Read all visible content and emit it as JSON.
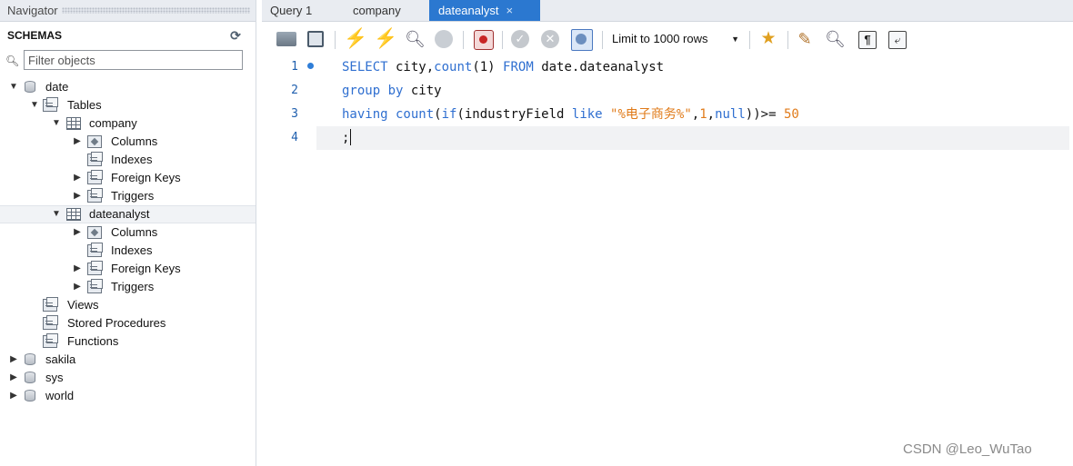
{
  "navigator": {
    "header": "Navigator",
    "section": "SCHEMAS",
    "filter_placeholder": "Filter objects",
    "tree": {
      "db_date": "date",
      "tables": "Tables",
      "company": "company",
      "company_columns": "Columns",
      "company_indexes": "Indexes",
      "company_fkeys": "Foreign Keys",
      "company_triggers": "Triggers",
      "dateanalyst": "dateanalyst",
      "da_columns": "Columns",
      "da_indexes": "Indexes",
      "da_fkeys": "Foreign Keys",
      "da_triggers": "Triggers",
      "views": "Views",
      "procs": "Stored Procedures",
      "functions": "Functions",
      "db_sakila": "sakila",
      "db_sys": "sys",
      "db_world": "world"
    }
  },
  "tabs": {
    "query1": "Query 1",
    "company": "company",
    "dateanalyst": "dateanalyst",
    "close": "×"
  },
  "toolbar": {
    "limit": "Limit to 1000 rows"
  },
  "editor": {
    "line_numbers": [
      "1",
      "2",
      "3",
      "4"
    ],
    "l1": {
      "select": "SELECT",
      "city": " city,",
      "count": "count",
      "arg": "(1)",
      "from": " FROM ",
      "table": "date.dateanalyst"
    },
    "l2": {
      "group": "group by",
      "city": " city"
    },
    "l3": {
      "having": "having",
      "count": " count",
      "paren1": "(",
      "if": "if",
      "expr": "(industryField ",
      "like": "like",
      "sp": " ",
      "str": "\"%电子商务%\"",
      "c1": ",",
      "one": "1",
      "c2": ",",
      "null": "null",
      "close": "))>=",
      "sp2": " ",
      "num": "50"
    },
    "l4": {
      "semi": ";"
    }
  },
  "watermark": "CSDN @Leo_WuTao"
}
